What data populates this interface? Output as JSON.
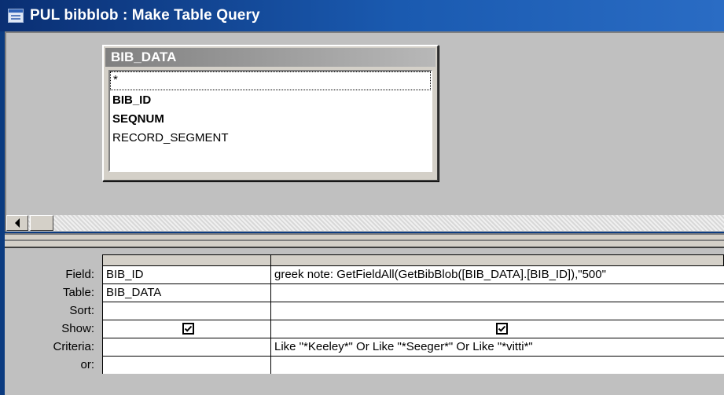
{
  "window": {
    "title": "PUL bibblob : Make Table Query"
  },
  "table": {
    "name": "BIB_DATA",
    "fields": [
      {
        "label": "*",
        "bold": false
      },
      {
        "label": "BIB_ID",
        "bold": true
      },
      {
        "label": "SEQNUM",
        "bold": true
      },
      {
        "label": "RECORD_SEGMENT",
        "bold": false
      }
    ]
  },
  "grid": {
    "row_labels": {
      "field": "Field:",
      "table": "Table:",
      "sort": "Sort:",
      "show": "Show:",
      "criteria": "Criteria:",
      "or": "or:"
    },
    "columns": [
      {
        "field": "BIB_ID",
        "table": "BIB_DATA",
        "sort": "",
        "show": true,
        "criteria": "",
        "or": ""
      },
      {
        "field": "greek note: GetFieldAll(GetBibBlob([BIB_DATA].[BIB_ID]),\"500\"",
        "table": "",
        "sort": "",
        "show": true,
        "criteria": "Like \"*Keeley*\" Or Like \"*Seeger*\" Or Like \"*vitti*\"",
        "or": ""
      }
    ]
  },
  "icons": {
    "window": "query-window-icon",
    "scroll_left": "scroll-left-arrow-icon",
    "checkbox": "checkbox-checked-icon"
  },
  "colors": {
    "titlebar": "#0a2f73",
    "desktop": "#0b3b80",
    "pane": "#c0c0c0"
  }
}
